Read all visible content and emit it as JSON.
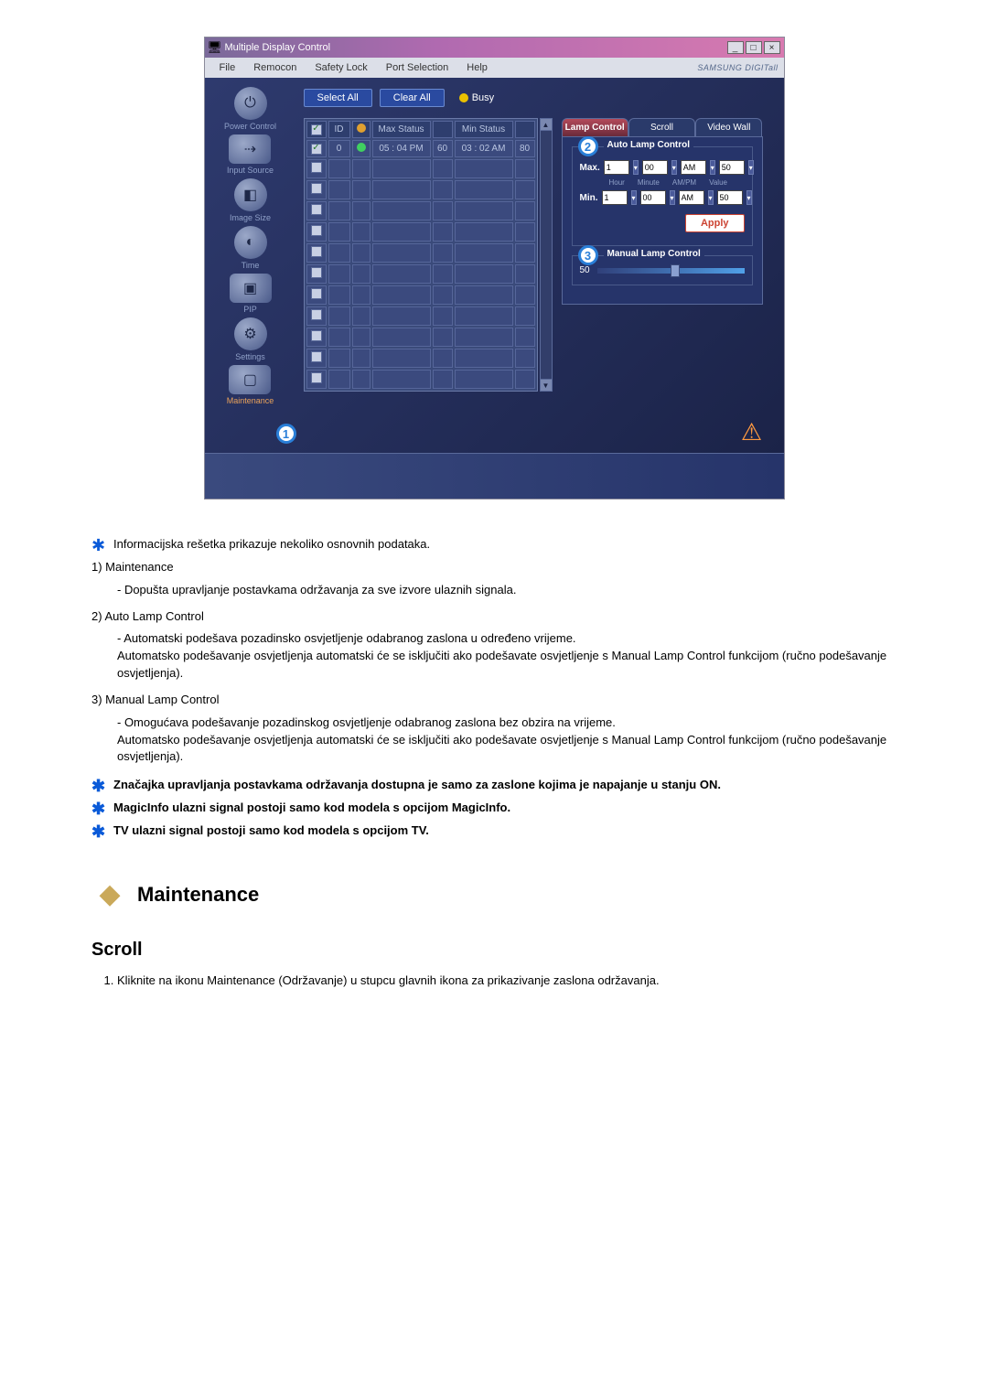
{
  "window": {
    "title": "Multiple Display Control",
    "brand": "SAMSUNG DIGITall"
  },
  "menu": {
    "file": "File",
    "remocon": "Remocon",
    "safety_lock": "Safety Lock",
    "port_selection": "Port Selection",
    "help": "Help"
  },
  "sidebar": {
    "items": [
      {
        "label": "Power Control",
        "glyph": "⏻"
      },
      {
        "label": "Input Source",
        "glyph": "⇢"
      },
      {
        "label": "Image Size",
        "glyph": "◧"
      },
      {
        "label": "Time",
        "glyph": "◐"
      },
      {
        "label": "PIP",
        "glyph": "▣"
      },
      {
        "label": "Settings",
        "glyph": "⚙"
      },
      {
        "label": "Maintenance",
        "glyph": "▢",
        "active": true
      }
    ]
  },
  "toolbar": {
    "select_all": "Select All",
    "clear_all": "Clear All",
    "busy": "Busy"
  },
  "grid": {
    "headers": {
      "check": "✓",
      "id": "ID",
      "status": "",
      "max_status": "Max Status",
      "max_val": "",
      "min_status": "Min Status",
      "min_val": ""
    },
    "rows": [
      {
        "checked": true,
        "id": "0",
        "dot": "green",
        "max": "05 : 04 PM",
        "mv": "60",
        "min": "03 : 02 AM",
        "nv": "80"
      },
      {
        "checked": false
      },
      {
        "checked": false
      },
      {
        "checked": false
      },
      {
        "checked": false
      },
      {
        "checked": false
      },
      {
        "checked": false
      },
      {
        "checked": false
      },
      {
        "checked": false
      },
      {
        "checked": false
      },
      {
        "checked": false
      },
      {
        "checked": false
      }
    ]
  },
  "panel": {
    "tabs": {
      "lamp": "Lamp Control",
      "scroll": "Scroll",
      "videowall": "Video Wall"
    },
    "auto": {
      "title": "Auto Lamp Control",
      "max": "Max.",
      "min": "Min.",
      "hour": "1",
      "minute": "00",
      "ampm": "AM",
      "value": "50",
      "sub_hour": "Hour",
      "sub_minute": "Minute",
      "sub_ampm": "AM/PM",
      "sub_value": "Value",
      "apply": "Apply"
    },
    "manual": {
      "title": "Manual Lamp Control",
      "value": "50"
    }
  },
  "callouts": {
    "one": "1",
    "two": "2",
    "three": "3"
  },
  "doc": {
    "p1": "Informacijska rešetka prikazuje nekoliko osnovnih podataka.",
    "n1": "1) Maintenance",
    "n1a": "- Dopušta upravljanje postavkama održavanja za sve izvore ulaznih signala.",
    "n2": "2) Auto Lamp Control",
    "n2a": "- Automatski podešava pozadinsko osvjetljenje odabranog zaslona u određeno vrijeme.",
    "n2b": "Automatsko podešavanje osvjetljenja automatski će se isključiti ako podešavate osvjetljenje s Manual Lamp Control funkcijom (ručno podešavanje osvjetljenja).",
    "n3": "3) Manual Lamp Control",
    "n3a": "- Omogućava podešavanje pozadinskog osvjetljenje odabranog zaslona bez obzira na vrijeme.",
    "n3b": "Automatsko podešavanje osvjetljenja automatski će se isključiti ako podešavate osvjetljenje s Manual Lamp Control funkcijom (ručno podešavanje osvjetljenja).",
    "b1": "Značajka upravljanja postavkama održavanja dostupna je samo za zaslone kojima je napajanje u stanju ON.",
    "b2": "MagicInfo ulazni signal postoji samo kod modela s opcijom MagicInfo.",
    "b3": "TV ulazni signal postoji samo kod modela s opcijom TV.",
    "section": "Maintenance",
    "subsection": "Scroll",
    "step1": "Kliknite na ikonu Maintenance (Održavanje) u stupcu glavnih ikona za prikazivanje zaslona održavanja."
  }
}
